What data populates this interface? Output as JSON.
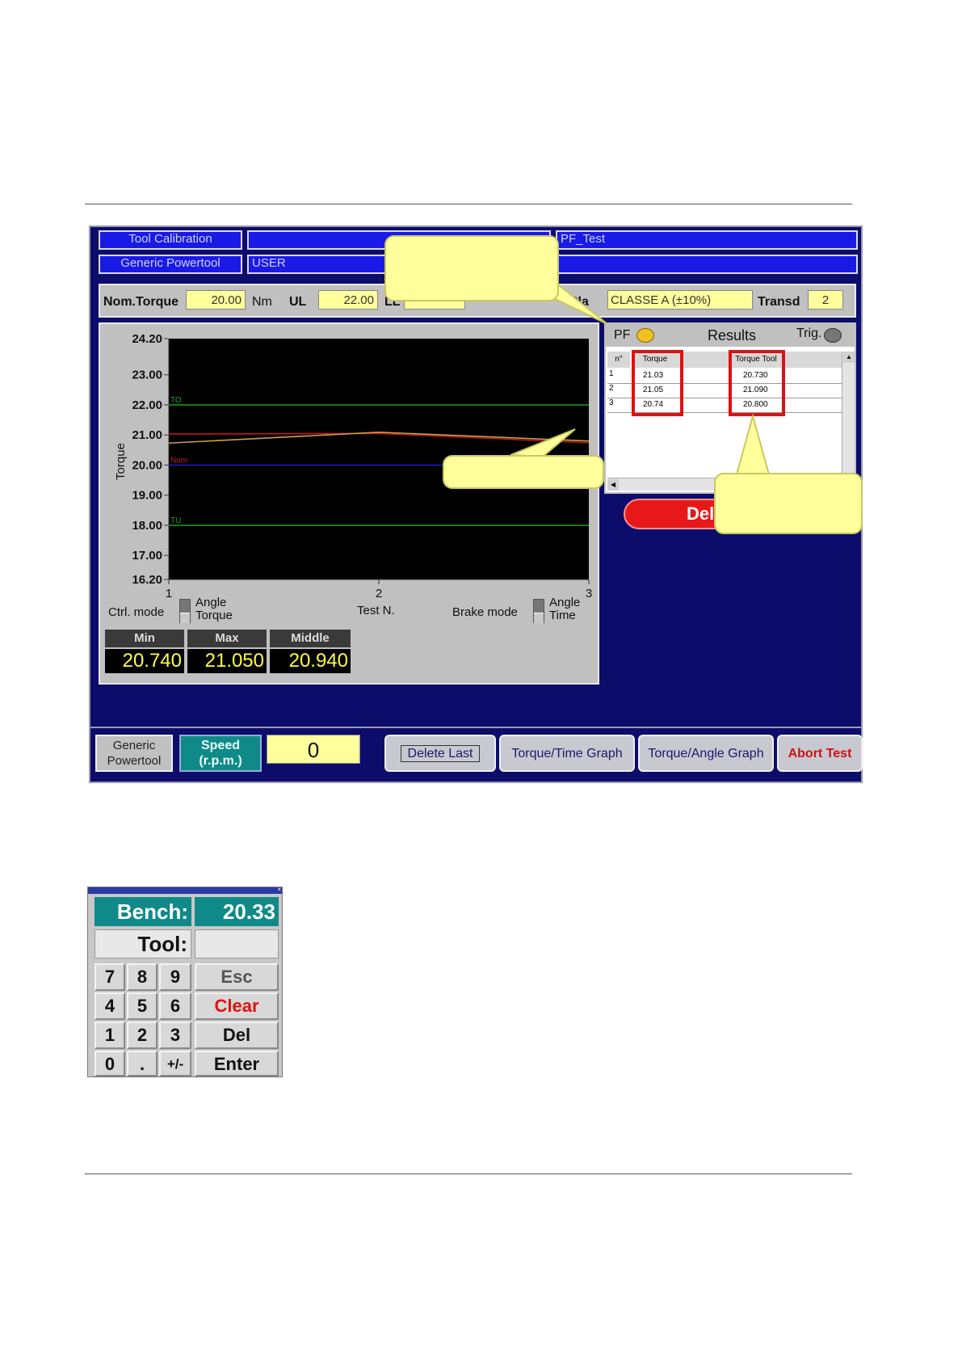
{
  "window": {
    "title_left": "Tool Calibration",
    "title_center": "",
    "title_right": "PF_Test",
    "subtitle_left": "Generic Powertool",
    "subtitle_center": "USER",
    "subtitle_right": ""
  },
  "params": {
    "nom_torque_label": "Nom.Torque",
    "nom_torque_value": "20.00",
    "nom_unit": "Nm",
    "ul_label": "UL",
    "ul_value": "22.00",
    "ll_label": "LL",
    "class_label": "Cla",
    "class_value": "CLASSE A (±10%)",
    "transd_label": "Transd",
    "transd_value": "2"
  },
  "results": {
    "pf_label": "PF",
    "title": "Results",
    "trig_label": "Trig.",
    "columns": [
      "n°",
      "Torque",
      "Torque Tool"
    ],
    "rows": [
      {
        "n": "1",
        "torque": "21.03",
        "torque_tool": "20.730"
      },
      {
        "n": "2",
        "torque": "21.05",
        "torque_tool": "21.090"
      },
      {
        "n": "3",
        "torque": "20.74",
        "torque_tool": "20.800"
      }
    ],
    "del_button": "Del"
  },
  "chart_data": {
    "type": "line",
    "ylabel": "Torque",
    "xlabel": "Test N.",
    "ylim": [
      16.2,
      24.2
    ],
    "y_ticks": [
      "24.20",
      "23.00",
      "22.00",
      "21.00",
      "20.00",
      "19.00",
      "18.00",
      "17.00",
      "16.20"
    ],
    "x_ticks": [
      "1",
      "2",
      "3"
    ],
    "reference_lines": [
      {
        "label": "TO",
        "value": 22.0,
        "color": "#1fa01f"
      },
      {
        "label": "Nom",
        "value": 20.0,
        "color": "#2020c0"
      },
      {
        "label": "TU",
        "value": 18.0,
        "color": "#1fa01f"
      }
    ],
    "series": [
      {
        "x": [
          1,
          2,
          3
        ],
        "values": [
          21.03,
          21.05,
          20.74
        ],
        "color": "#c01818"
      },
      {
        "x": [
          1,
          2,
          3
        ],
        "values": [
          20.73,
          21.09,
          20.8
        ],
        "color": "#c8a050"
      }
    ]
  },
  "modes": {
    "ctrl_label": "Ctrl. mode",
    "ctrl_opt1": "Angle",
    "ctrl_opt2": "Torque",
    "brake_label": "Brake mode",
    "brake_opt1": "Angle",
    "brake_opt2": "Time"
  },
  "stats": {
    "min_label": "Min",
    "min_value": "20.740",
    "max_label": "Max",
    "max_value": "21.050",
    "middle_label": "Middle",
    "middle_value": "20.940"
  },
  "bottom": {
    "tool_line1": "Generic",
    "tool_line2": "Powertool",
    "speed_line1": "Speed",
    "speed_line2": "(r.p.m.)",
    "speed_value": "0",
    "delete_last": "Delete Last",
    "torque_time": "Torque/Time Graph",
    "torque_angle": "Torque/Angle Graph",
    "abort": "Abort Test"
  },
  "keypad": {
    "bench_label": "Bench:",
    "bench_value": "20.33",
    "tool_label": "Tool:",
    "tool_value": "",
    "keys": [
      "7",
      "8",
      "9",
      "4",
      "5",
      "6",
      "1",
      "2",
      "3",
      "0",
      ".",
      "+/-"
    ],
    "esc": "Esc",
    "clear": "Clear",
    "del": "Del",
    "enter": "Enter"
  },
  "colors": {
    "app_bg": "#0c0c6a",
    "title_bar": "#1a1ae6",
    "field_yellow": "#ffff9c",
    "highlight_red": "#e01010",
    "teal": "#0f8a88"
  }
}
